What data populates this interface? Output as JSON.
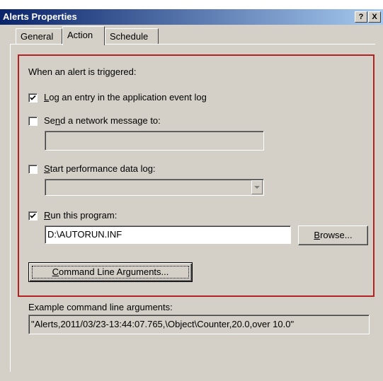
{
  "window": {
    "title": "Alerts Properties",
    "help_btn": "?",
    "close_btn": "X"
  },
  "tabs": [
    {
      "label": "General",
      "active": false
    },
    {
      "label": "Action",
      "active": true
    },
    {
      "label": "Schedule",
      "active": false
    }
  ],
  "action": {
    "heading": "When an alert is triggered:",
    "log_entry": {
      "pre": "",
      "key": "L",
      "post": "og an entry in the application event log",
      "checked": true
    },
    "send_message": {
      "pre": "Se",
      "key": "n",
      "post": "d a network message to:",
      "checked": false,
      "value": ""
    },
    "start_log": {
      "pre": "",
      "key": "S",
      "post": "tart performance data log:",
      "checked": false,
      "value": ""
    },
    "run_program": {
      "pre": "",
      "key": "R",
      "post": "un this program:",
      "checked": true,
      "value": "D:\\AUTORUN.INF"
    },
    "browse_button": {
      "pre": "",
      "key": "B",
      "post": "rowse..."
    },
    "cmd_args_button": {
      "pre": "",
      "key": "C",
      "post": "ommand Line Arguments..."
    },
    "example_label": "Example command line arguments:",
    "example_value": "\"Alerts,2011/03/23-13:44:07.765,\\Object\\Counter,20.0,over 10.0\""
  },
  "colors": {
    "highlight_border": "#b22222",
    "title_start": "#0a246a",
    "title_end": "#a6caf0",
    "face": "#d4d0c8"
  }
}
